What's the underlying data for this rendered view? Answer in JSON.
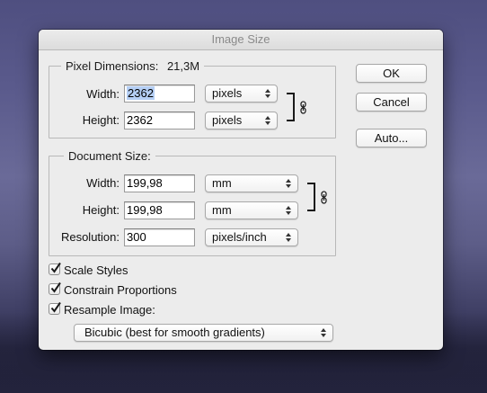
{
  "dialog": {
    "title": "Image Size"
  },
  "pixel_dimensions": {
    "heading": "Pixel Dimensions:",
    "size": "21,3M",
    "width_label": "Width:",
    "width_value": "2362",
    "width_unit": "pixels",
    "height_label": "Height:",
    "height_value": "2362",
    "height_unit": "pixels"
  },
  "document_size": {
    "heading": "Document Size:",
    "width_label": "Width:",
    "width_value": "199,98",
    "width_unit": "mm",
    "height_label": "Height:",
    "height_value": "199,98",
    "height_unit": "mm",
    "resolution_label": "Resolution:",
    "resolution_value": "300",
    "resolution_unit": "pixels/inch"
  },
  "buttons": {
    "ok": "OK",
    "cancel": "Cancel",
    "auto": "Auto..."
  },
  "options": {
    "scale_styles": {
      "label": "Scale Styles",
      "checked": true
    },
    "constrain_proportions": {
      "label": "Constrain Proportions",
      "checked": true
    },
    "resample_image": {
      "label": "Resample Image:",
      "checked": true
    },
    "resample_method": "Bicubic (best for smooth gradients)"
  },
  "icons": {
    "link": "chain-link-icon",
    "checkmark": "checkmark-icon"
  }
}
